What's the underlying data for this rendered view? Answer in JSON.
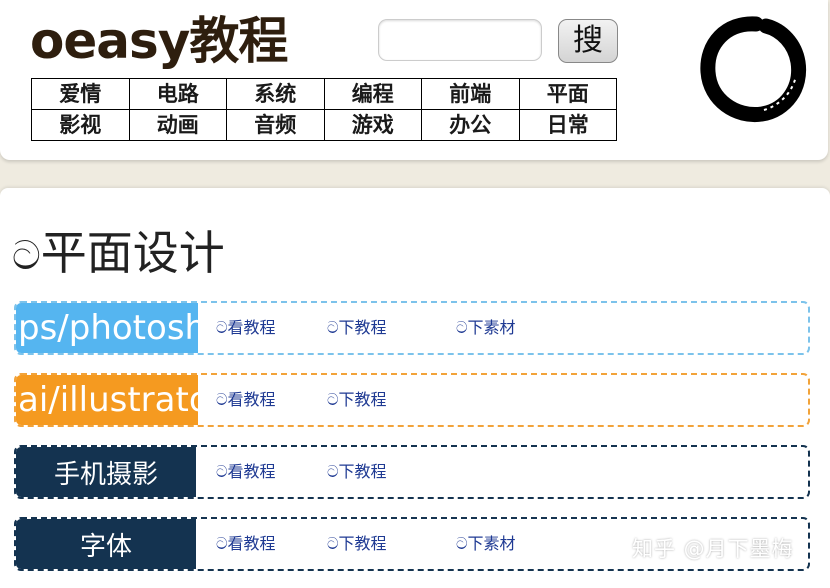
{
  "logo": {
    "text": "oeasy教程"
  },
  "search": {
    "placeholder": "",
    "button_label": "搜"
  },
  "nav": {
    "items": [
      "爱情",
      "电路",
      "系统",
      "编程",
      "前端",
      "平面",
      "影视",
      "动画",
      "音频",
      "游戏",
      "办公",
      "日常"
    ]
  },
  "section": {
    "glyph": "ට",
    "title": "平面设计"
  },
  "rows": [
    {
      "label": "ps/photoshop",
      "bg": "#55b5f0",
      "border": "#7cc3eb",
      "links": [
        "ට看教程",
        "ට下教程",
        "ට下素材"
      ]
    },
    {
      "label": "ai/illustrator",
      "bg": "#f59a20",
      "border": "#f2a33a",
      "links": [
        "ට看教程",
        "ට下教程"
      ]
    },
    {
      "label": "手机摄影",
      "bg": "#143350",
      "border": "#143350",
      "links": [
        "ට看教程",
        "ට下教程"
      ]
    },
    {
      "label": "字体",
      "bg": "#143350",
      "border": "#143350",
      "links": [
        "ට看教程",
        "ට下教程",
        "ට下素材"
      ]
    }
  ],
  "watermark": {
    "text": "知乎 @月下墨梅"
  },
  "colors": {
    "link": "#1f3a93",
    "logo": "#2e1e0e",
    "page_bg": "#efebe0"
  }
}
